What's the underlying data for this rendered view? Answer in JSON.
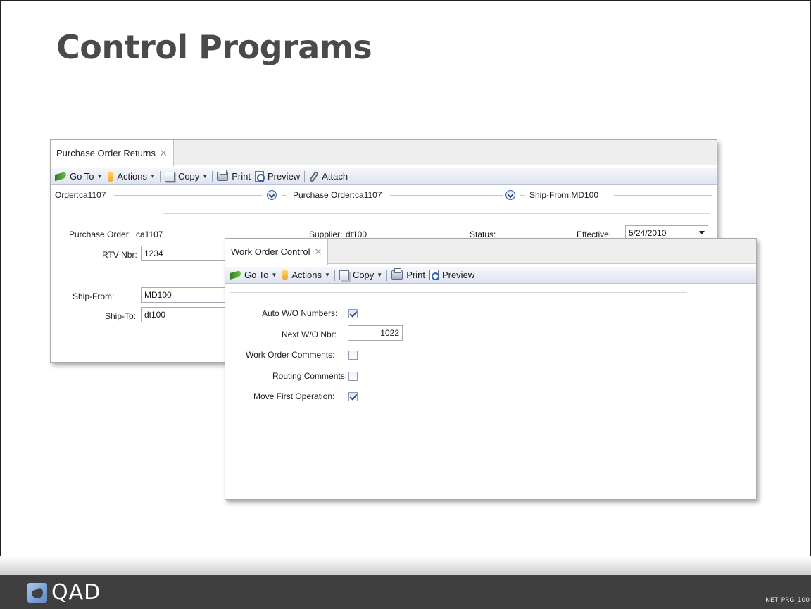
{
  "slide": {
    "title": "Control Programs",
    "code": "NET_PRG_100",
    "logo_text": "QAD"
  },
  "toolbar_common": {
    "goto": "Go To",
    "actions": "Actions",
    "copy": "Copy",
    "print": "Print",
    "preview": "Preview",
    "attach": "Attach"
  },
  "po_window": {
    "tab_label": "Purchase Order Returns",
    "close_glyph": "✕",
    "sections": {
      "order": "Order:ca1107",
      "purchase_order": "Purchase Order:ca1107",
      "ship_from": "Ship-From:MD100"
    },
    "fields": {
      "purchase_order_label": "Purchase Order:",
      "purchase_order_value": "ca1107",
      "supplier_label": "Supplier:",
      "supplier_value": "dt100",
      "status_label": "Status:",
      "effective_label": "Effective:",
      "effective_value": "5/24/2010",
      "rtv_label": "RTV Nbr:",
      "rtv_value": "1234",
      "ship_from_label": "Ship-From:",
      "ship_from_value": "MD100",
      "ship_to_label": "Ship-To:",
      "ship_to_value": "dt100"
    }
  },
  "wo_window": {
    "tab_label": "Work Order Control",
    "close_glyph": "✕",
    "fields": {
      "auto_numbers_label": "Auto W/O Numbers:",
      "auto_numbers_checked": true,
      "next_nbr_label": "Next W/O Nbr:",
      "next_nbr_value": "1022",
      "wo_comments_label": "Work Order Comments:",
      "wo_comments_checked": false,
      "routing_comments_label": "Routing Comments:",
      "routing_comments_checked": false,
      "move_first_label": "Move First Operation:",
      "move_first_checked": true
    }
  }
}
